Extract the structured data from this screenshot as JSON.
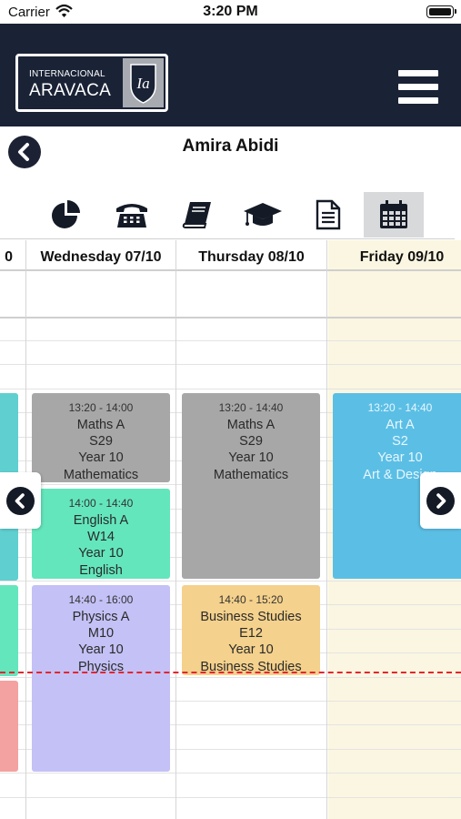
{
  "status_bar": {
    "carrier": "Carrier",
    "time": "3:20 PM"
  },
  "header": {
    "logo_line1": "INTERNACIONAL",
    "logo_line2": "ARAVACA",
    "logo_mark": "Ia"
  },
  "page": {
    "title": "Amira Abidi"
  },
  "tabs": [
    {
      "icon": "pie-chart-icon"
    },
    {
      "icon": "phone-icon"
    },
    {
      "icon": "book-icon"
    },
    {
      "icon": "graduation-cap-icon"
    },
    {
      "icon": "document-icon"
    },
    {
      "icon": "calendar-icon",
      "active": true
    }
  ],
  "calendar": {
    "columns": [
      {
        "label": "0"
      },
      {
        "label": "Wednesday 07/10"
      },
      {
        "label": "Thursday 08/10"
      },
      {
        "label": "Friday 09/10"
      }
    ],
    "events": {
      "wed1": {
        "time": "13:20 - 14:00",
        "subject": "Maths A",
        "room": "S29",
        "year": "Year 10",
        "department": "Mathematics",
        "color": "#a7a7a7"
      },
      "wed2": {
        "time": "14:00 - 14:40",
        "subject": "English A",
        "room": "W14",
        "year": "Year 10",
        "department": "English",
        "color": "#64e6bd"
      },
      "wed3": {
        "time": "14:40 - 16:00",
        "subject": "Physics A",
        "room": "M10",
        "year": "Year 10",
        "department": "Physics",
        "color": "#c4c1f6"
      },
      "thu1": {
        "time": "13:20 - 14:40",
        "subject": "Maths A",
        "room": "S29",
        "year": "Year 10",
        "department": "Mathematics",
        "color": "#a7a7a7"
      },
      "thu2": {
        "time": "14:40 - 15:20",
        "subject": "Business Studies",
        "room": "E12",
        "year": "Year 10",
        "department": "Business Studies",
        "color": "#f4d18c"
      },
      "fri1": {
        "time": "13:20 - 14:40",
        "subject": "Art A",
        "room": "S2",
        "year": "Year 10",
        "department": "Art & Design",
        "color": "#5bbfe5"
      }
    },
    "partial_colors": {
      "teal": "#5fcfcf",
      "green": "#64e6bd",
      "red": "#f4a1a1"
    }
  },
  "colors": {
    "header_bg": "#1a2236",
    "now_line": "#e3262f",
    "friday_bg": "#fbf6e1"
  }
}
